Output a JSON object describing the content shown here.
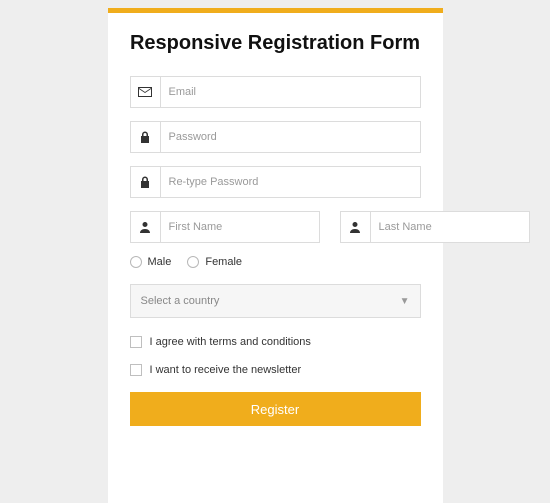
{
  "title": "Responsive Registration Form",
  "fields": {
    "email": {
      "placeholder": "Email"
    },
    "password": {
      "placeholder": "Password"
    },
    "repassword": {
      "placeholder": "Re-type Password"
    },
    "firstname": {
      "placeholder": "First Name"
    },
    "lastname": {
      "placeholder": "Last Name"
    }
  },
  "gender": {
    "male": "Male",
    "female": "Female"
  },
  "country": {
    "placeholder": "Select a country"
  },
  "terms": "I agree with terms and conditions",
  "newsletter": "I want to receive the newsletter",
  "submit": "Register"
}
